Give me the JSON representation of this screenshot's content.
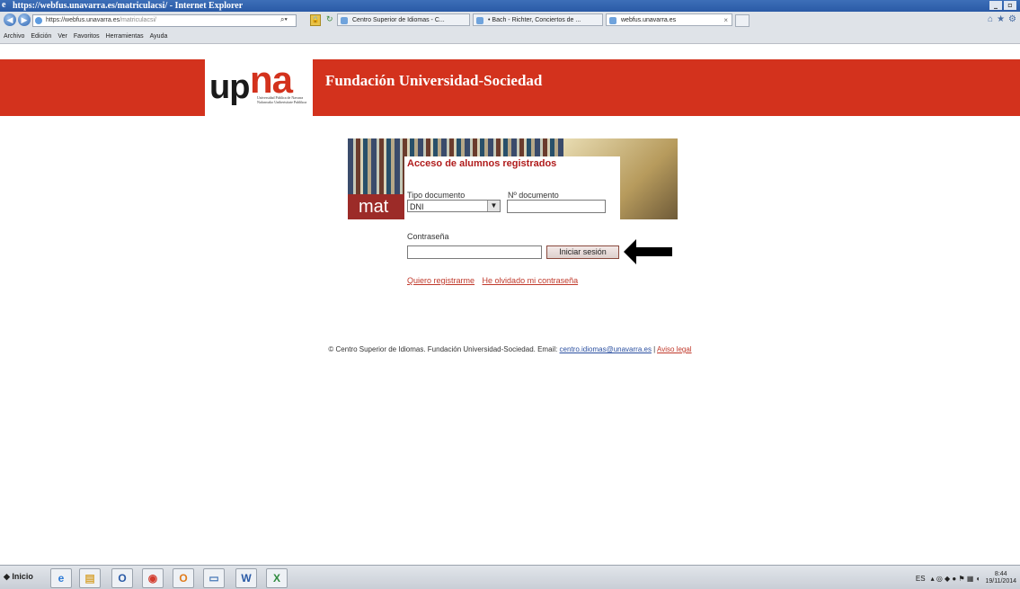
{
  "window": {
    "title": "https://webfus.unavarra.es/matriculacsi/ - Internet Explorer"
  },
  "address": {
    "domain": "https://webfus.unavarra.es",
    "path": "/matriculacsi/"
  },
  "tabs": [
    {
      "label": "Centro Superior de Idiomas - C..."
    },
    {
      "label": "• Bach - Richter, Conciertos de ..."
    },
    {
      "label": "webfus.unavarra.es"
    }
  ],
  "menu": [
    "Archivo",
    "Edición",
    "Ver",
    "Favoritos",
    "Herramientas",
    "Ayuda"
  ],
  "header": {
    "logo_up": "up",
    "logo_na": "na",
    "logo_small_1": "Universidad Pública de Navarra",
    "logo_small_2": "Nafarroako Unibertsitate Publikoa",
    "title": "Fundación Universidad-Sociedad"
  },
  "card": {
    "mat_text": "mat"
  },
  "form": {
    "title": "Acceso de alumnos registrados",
    "doc_type_label": "Tipo documento",
    "doc_type_value": "DNI",
    "doc_number_label": "Nº documento",
    "doc_number_value": "",
    "password_label": "Contraseña",
    "password_value": "",
    "submit_label": "Iniciar sesión",
    "register_link": "Quiero registrarme",
    "forgot_link": "He olvidado mi contraseña"
  },
  "footer": {
    "text": "© Centro Superior de Idiomas. Fundación Universidad-Sociedad. Email: ",
    "email": "centro.idiomas@unavarra.es",
    "separator": " | ",
    "legal": "Aviso legal"
  },
  "taskbar": {
    "start_label": "Inicio",
    "apps": [
      "e",
      "▤",
      "O",
      "◉",
      "O",
      "▭",
      "W",
      "X"
    ],
    "lang": "ES",
    "time": "8:44",
    "date": "19/11/2014"
  },
  "colors": {
    "banner": "#d3321d",
    "form_title": "#b01c1c",
    "link": "#c0392b"
  }
}
